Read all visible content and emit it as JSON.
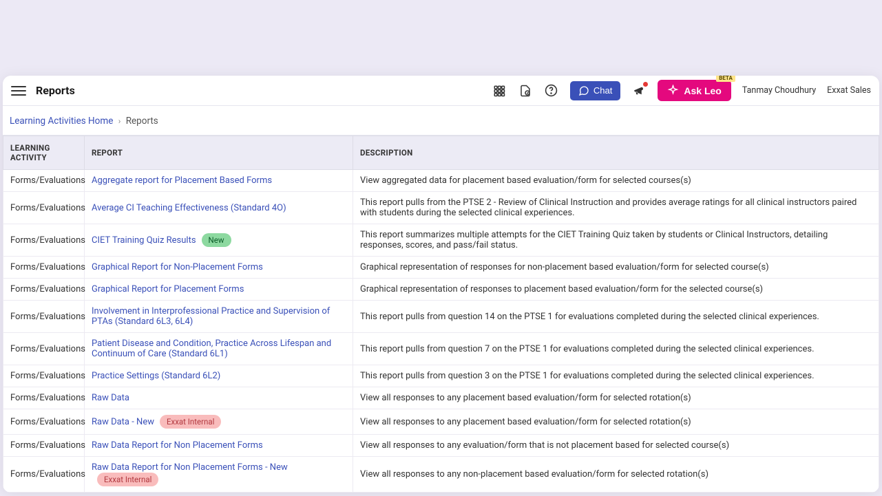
{
  "header": {
    "title": "Reports",
    "chat_label": "Chat",
    "ask_leo_label": "Ask Leo",
    "beta_tag": "BETA",
    "user_name": "Tanmay Choudhury",
    "org_name": "Exxat Sales"
  },
  "breadcrumb": {
    "home": "Learning Activities Home",
    "current": "Reports"
  },
  "table": {
    "headers": {
      "activity": "LEARNING ACTIVITY",
      "report": "REPORT",
      "description": "DESCRIPTION"
    },
    "rows": [
      {
        "activity": "Forms/Evaluations",
        "report": "Aggregate report for Placement Based Forms",
        "description": "View aggregated data for placement based evaluation/form for selected courses(s)"
      },
      {
        "activity": "Forms/Evaluations",
        "report": "Average CI Teaching Effectiveness (Standard 4O)",
        "description": "This report pulls from the PTSE 2 - Review of Clinical Instruction and provides average ratings for all clinical instructors paired with students during the selected clinical experiences."
      },
      {
        "activity": "Forms/Evaluations",
        "report": "CIET Training Quiz Results",
        "badge": "New",
        "badge_type": "new",
        "description": "This report summarizes multiple attempts for the CIET Training Quiz taken by students or Clinical Instructors, detailing responses, scores, and pass/fail status."
      },
      {
        "activity": "Forms/Evaluations",
        "report": "Graphical Report for Non-Placement Forms",
        "description": "Graphical representation of responses for non-placement based evaluation/form for selected course(s)"
      },
      {
        "activity": "Forms/Evaluations",
        "report": "Graphical Report for Placement Forms",
        "description": "Graphical representation of responses to placement based evaluation/form for the selected course(s)"
      },
      {
        "activity": "Forms/Evaluations",
        "report": "Involvement in Interprofessional Practice and Supervision of PTAs (Standard 6L3, 6L4)",
        "description": "This report pulls from question 14 on the PTSE 1 for evaluations completed during the selected clinical experiences."
      },
      {
        "activity": "Forms/Evaluations",
        "report": "Patient Disease and Condition, Practice Across Lifespan and Continuum of Care (Standard 6L1)",
        "description": "This report pulls from question 7 on the PTSE 1 for evaluations completed during the selected clinical experiences."
      },
      {
        "activity": "Forms/Evaluations",
        "report": "Practice Settings (Standard 6L2)",
        "description": "This report pulls from question 3 on the PTSE 1 for evaluations completed during the selected clinical experiences."
      },
      {
        "activity": "Forms/Evaluations",
        "report": "Raw Data",
        "description": "View all responses to any placement based evaluation/form for selected rotation(s)"
      },
      {
        "activity": "Forms/Evaluations",
        "report": "Raw Data - New",
        "badge": "Exxat Internal",
        "badge_type": "internal",
        "description": "View all responses to any placement based evaluation/form for selected rotation(s)"
      },
      {
        "activity": "Forms/Evaluations",
        "report": "Raw Data Report for Non Placement Forms",
        "description": "View all responses to any evaluation/form that is not placement based for selected course(s)"
      },
      {
        "activity": "Forms/Evaluations",
        "report": "Raw Data Report for Non Placement Forms - New",
        "badge": "Exxat Internal",
        "badge_type": "internal",
        "description": "View all responses to any non-placement based evaluation/form for selected rotation(s)"
      }
    ]
  }
}
